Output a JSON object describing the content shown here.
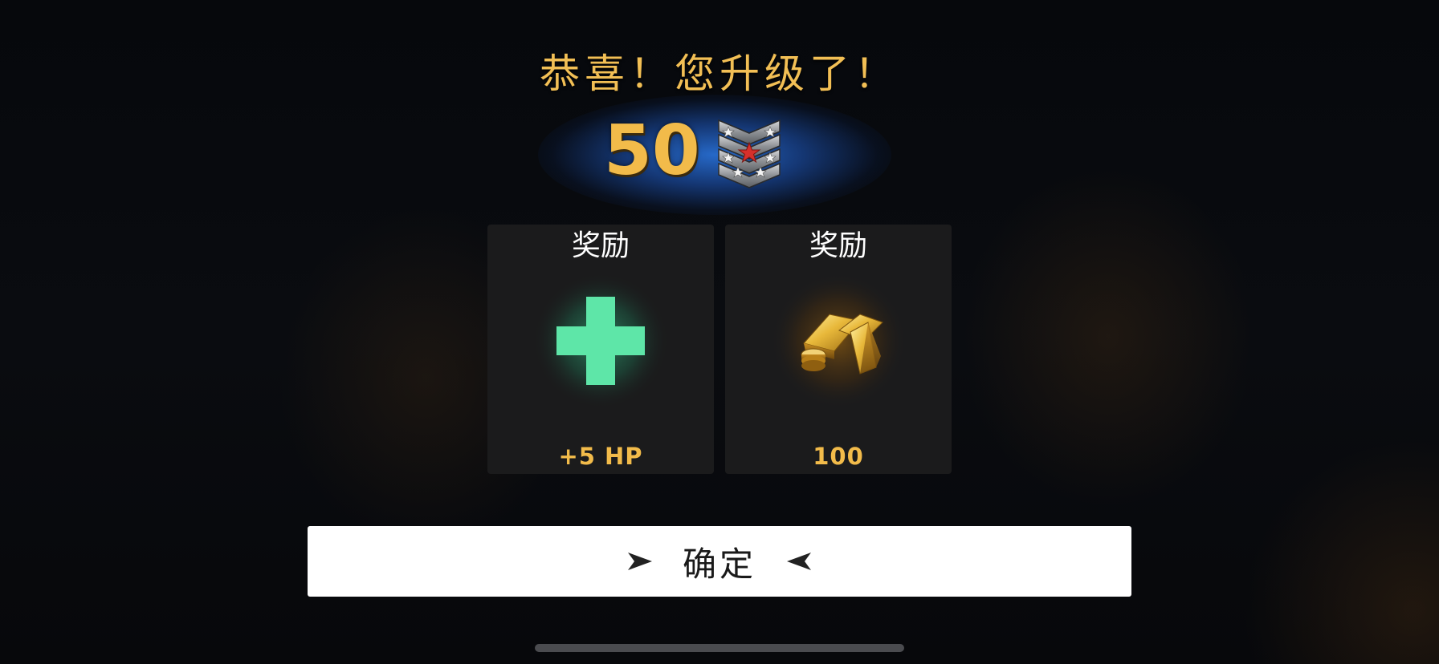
{
  "dialog": {
    "title": "恭喜！您升级了！",
    "level": "50",
    "rank_icon": "rank-chevron-star-badge-icon"
  },
  "rewards": [
    {
      "label": "奖励",
      "value": "+5 HP",
      "icon": "health-cross-icon",
      "color": "#5ee6a8"
    },
    {
      "label": "奖励",
      "value": "100",
      "icon": "gold-bars-icon",
      "color": "#f2bb4a"
    }
  ],
  "confirm_button": {
    "label": "确定",
    "left_icon": "arrow-right-icon",
    "right_icon": "arrow-left-icon"
  },
  "colors": {
    "accent_gold": "#f2bb4a",
    "level_glow_blue": "#2b6fd0",
    "card_bg": "#1b1b1c",
    "button_bg": "#ffffff"
  }
}
